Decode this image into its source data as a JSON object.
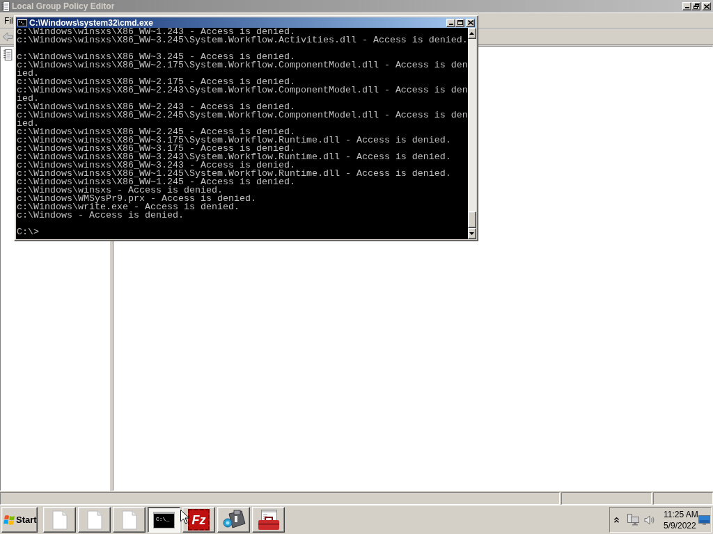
{
  "editor_window": {
    "title": "Local Group Policy Editor",
    "active": false,
    "menu": [
      "Fil"
    ]
  },
  "console_window": {
    "title": "C:\\Windows\\system32\\cmd.exe",
    "active": true,
    "blocks": [
      [
        "c:\\Windows\\winsxs\\X86_WW~1.243 - Access is denied.",
        "c:\\Windows\\winsxs\\X86_WW~3.245\\System.Workflow.Activities.dll - Access is denied."
      ],
      [
        "c:\\Windows\\winsxs\\X86_WW~3.245 - Access is denied.",
        "c:\\Windows\\winsxs\\X86_WW~2.175\\System.Workflow.ComponentModel.dll - Access is den",
        "ied.",
        "c:\\Windows\\winsxs\\X86_WW~2.175 - Access is denied.",
        "c:\\Windows\\winsxs\\X86_WW~2.243\\System.Workflow.ComponentModel.dll - Access is den",
        "ied.",
        "c:\\Windows\\winsxs\\X86_WW~2.243 - Access is denied.",
        "c:\\Windows\\winsxs\\X86_WW~2.245\\System.Workflow.ComponentModel.dll - Access is den",
        "ied.",
        "c:\\Windows\\winsxs\\X86_WW~2.245 - Access is denied.",
        "c:\\Windows\\winsxs\\X86_WW~3.175\\System.Workflow.Runtime.dll - Access is denied.",
        "c:\\Windows\\winsxs\\X86_WW~3.175 - Access is denied.",
        "c:\\Windows\\winsxs\\X86_WW~3.243\\System.Workflow.Runtime.dll - Access is denied.",
        "c:\\Windows\\winsxs\\X86_WW~3.243 - Access is denied.",
        "c:\\Windows\\winsxs\\X86_WW~1.245\\System.Workflow.Runtime.dll - Access is denied.",
        "c:\\Windows\\winsxs\\X86_WW~1.245 - Access is denied.",
        "c:\\Windows\\winsxs - Access is denied.",
        "c:\\Windows\\WMSysPr9.prx - Access is denied.",
        "c:\\Windows\\write.exe - Access is denied.",
        "c:\\Windows - Access is denied."
      ],
      [
        "C:\\>"
      ]
    ]
  },
  "taskbar": {
    "start": "Start",
    "buttons": [
      {
        "kind": "document",
        "selected": false
      },
      {
        "kind": "document",
        "selected": false
      },
      {
        "kind": "document",
        "selected": false
      },
      {
        "kind": "console",
        "selected": true,
        "icon_text": "C:\\_"
      },
      {
        "kind": "ftp",
        "selected": false,
        "icon_text": "Fz"
      },
      {
        "kind": "camera",
        "selected": false
      },
      {
        "kind": "toolbox",
        "selected": false
      }
    ],
    "clock": {
      "time": "11:25 AM",
      "date": "5/9/2022"
    }
  }
}
